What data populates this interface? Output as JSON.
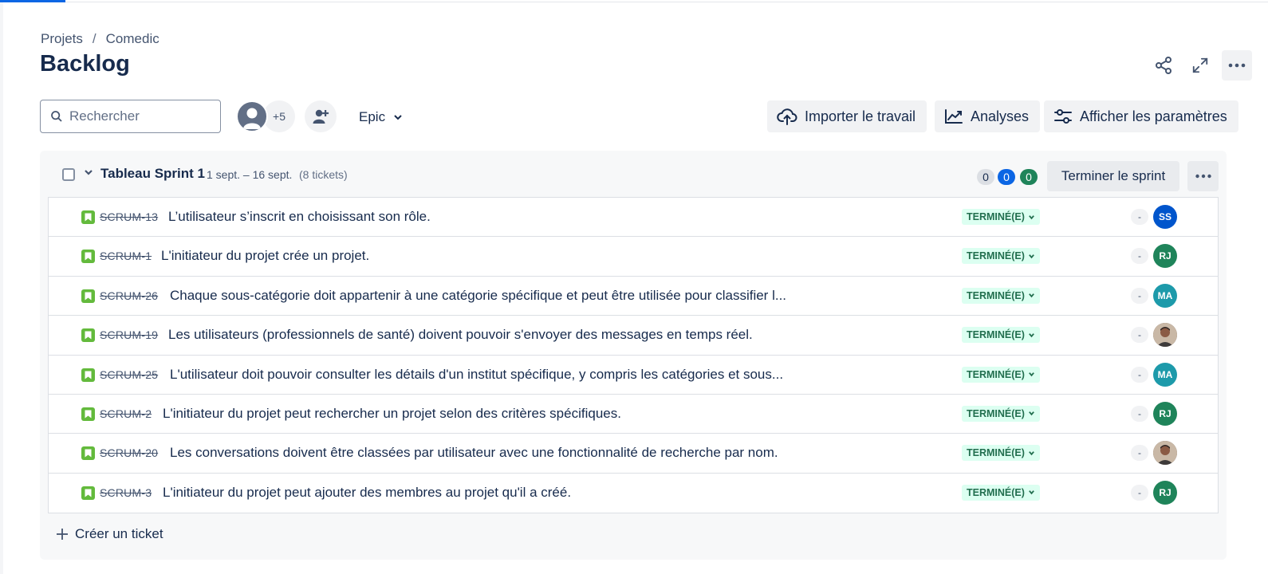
{
  "breadcrumb": {
    "projects": "Projets",
    "separator": "/",
    "project": "Comedic"
  },
  "page": {
    "title": "Backlog"
  },
  "header_icons": [
    "share-icon",
    "fullscreen-icon",
    "more-icon"
  ],
  "search": {
    "placeholder": "Rechercher"
  },
  "people": {
    "more_count": "+5"
  },
  "filters": {
    "epic_label": "Epic"
  },
  "toolbar": {
    "import_label": "Importer le travail",
    "insights_label": "Analyses",
    "view_settings_label": "Afficher les paramètres"
  },
  "sprint": {
    "name": "Tableau Sprint 1",
    "dates": "1 sept. – 16 sept.",
    "ticket_count": "(8 tickets)",
    "counts": {
      "todo": "0",
      "in_progress": "0",
      "done": "0"
    },
    "complete_label": "Terminer le sprint",
    "issues": [
      {
        "key": "SCRUM-13",
        "summary": "L’utilisateur s’inscrit en choisissant son rôle.",
        "status": "TERMINÉ(E)",
        "estimate": "-",
        "assignee": "SS",
        "assignee_color": "#0055cc",
        "photo": false
      },
      {
        "key": "SCRUM-1",
        "summary": "L'initiateur du projet crée un projet.",
        "status": "TERMINÉ(E)",
        "estimate": "-",
        "assignee": "RJ",
        "assignee_color": "#1f845a",
        "photo": false
      },
      {
        "key": "SCRUM-26",
        "summary": "Chaque sous-catégorie doit appartenir à une catégorie spécifique et peut être utilisée pour classifier l...",
        "status": "TERMINÉ(E)",
        "estimate": "-",
        "assignee": "MA",
        "assignee_color": "#1d9aaa",
        "photo": false
      },
      {
        "key": "SCRUM-19",
        "summary": "Les utilisateurs (professionnels de santé) doivent pouvoir s'envoyer des messages en temps réel.",
        "status": "TERMINÉ(E)",
        "estimate": "-",
        "assignee": "",
        "assignee_color": "#6b5b4e",
        "photo": true
      },
      {
        "key": "SCRUM-25",
        "summary": "L'utilisateur doit pouvoir consulter les détails d'un institut spécifique, y compris les catégories et sous...",
        "status": "TERMINÉ(E)",
        "estimate": "-",
        "assignee": "MA",
        "assignee_color": "#1d9aaa",
        "photo": false
      },
      {
        "key": "SCRUM-2",
        "summary": "L'initiateur du projet peut rechercher un projet selon des critères spécifiques.",
        "status": "TERMINÉ(E)",
        "estimate": "-",
        "assignee": "RJ",
        "assignee_color": "#1f845a",
        "photo": false
      },
      {
        "key": "SCRUM-20",
        "summary": "Les conversations doivent être classées par utilisateur avec une fonctionnalité de recherche par nom.",
        "status": "TERMINÉ(E)",
        "estimate": "-",
        "assignee": "",
        "assignee_color": "#6b5b4e",
        "photo": true
      },
      {
        "key": "SCRUM-3",
        "summary": "L'initiateur du projet peut ajouter des membres au projet qu'il a créé.",
        "status": "TERMINÉ(E)",
        "estimate": "-",
        "assignee": "RJ",
        "assignee_color": "#1f845a",
        "photo": false
      }
    ]
  },
  "create_issue": {
    "label": "Créer un ticket"
  },
  "colors": {
    "accent": "#0c66e4",
    "done": "#1f845a",
    "story": "#63ba3c",
    "status_bg": "#dcfff1",
    "status_text": "#216e4e"
  }
}
